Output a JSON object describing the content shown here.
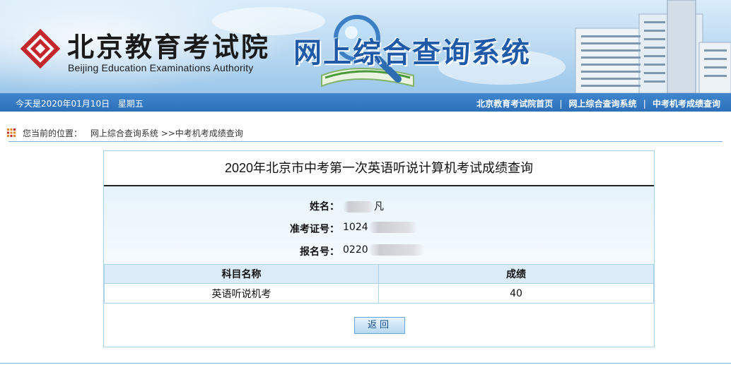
{
  "header": {
    "org_name_cn": "北京教育考试院",
    "org_name_en": "Beijing Education Examinations Authority",
    "system_title": "网上综合查询系统"
  },
  "strip": {
    "date_text": "今天是2020年01月10日",
    "weekday": "星期五",
    "nav": [
      "北京教育考试院首页",
      "网上综合查询系统",
      "中考机考成绩查询"
    ],
    "separator": "|"
  },
  "breadcrumb": {
    "prefix": "您当前的位置：",
    "link": "网上综合查询系统",
    "rest": ">>中考机考成绩查询"
  },
  "result": {
    "title": "2020年北京市中考第一次英语听说计算机考试成绩查询",
    "name_label": "姓名：",
    "name_value": "凡",
    "exam_no_label": "准考证号：",
    "exam_no_value": "1024",
    "reg_no_label": "报名号：",
    "reg_no_value": "0220",
    "table": {
      "headers": [
        "科目名称",
        "成绩"
      ],
      "rows": [
        [
          "英语听说机考",
          "40"
        ]
      ]
    },
    "back_button": "返回"
  },
  "colors": {
    "banner_top": "#d9ecfa",
    "strip": "#3479c2",
    "title_blue": "#1f5aa8",
    "border": "#a9d3ea"
  }
}
